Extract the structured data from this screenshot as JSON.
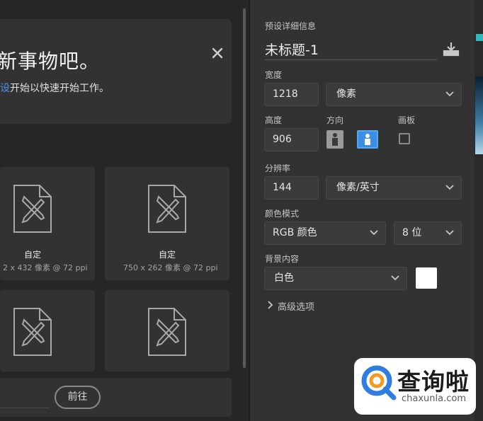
{
  "left_panel": {
    "banner": {
      "title": "新事物吧。",
      "subtitle_link": "设",
      "subtitle_rest": "开始以快速开始工作。"
    },
    "cards": [
      {
        "title": "自定",
        "subtitle": "2 x 432 像素 @ 72 ppi",
        "icon": "document-design-icon"
      },
      {
        "title": "自定",
        "subtitle": "750 x 262 像素 @ 72 ppi",
        "icon": "document-design-icon"
      },
      {
        "title": "",
        "subtitle": "",
        "icon": "document-design-icon"
      },
      {
        "title": "",
        "subtitle": "",
        "icon": "document-design-icon"
      }
    ],
    "goto_button": "前往"
  },
  "preset_details": {
    "section_label": "预设详细信息",
    "document_name": "未标题-1",
    "width": {
      "label": "宽度",
      "value": "1218",
      "unit": "像素"
    },
    "height": {
      "label": "高度",
      "value": "906"
    },
    "orientation": {
      "label": "方向"
    },
    "artboard": {
      "label": "画板",
      "checked": false
    },
    "resolution": {
      "label": "分辨率",
      "value": "144",
      "unit": "像素/英寸"
    },
    "color_mode": {
      "label": "颜色模式",
      "mode": "RGB 颜色",
      "depth": "8 位"
    },
    "background": {
      "label": "背景内容",
      "value": "白色",
      "swatch_color": "#ffffff"
    },
    "advanced": {
      "label": "高级选项"
    }
  },
  "watermark": {
    "text": "查询啦",
    "url": "chaxunla.com"
  },
  "colors": {
    "accent": "#3a8ee6",
    "link": "#4f95e8",
    "panel": "#323232",
    "bg": "#262626"
  }
}
